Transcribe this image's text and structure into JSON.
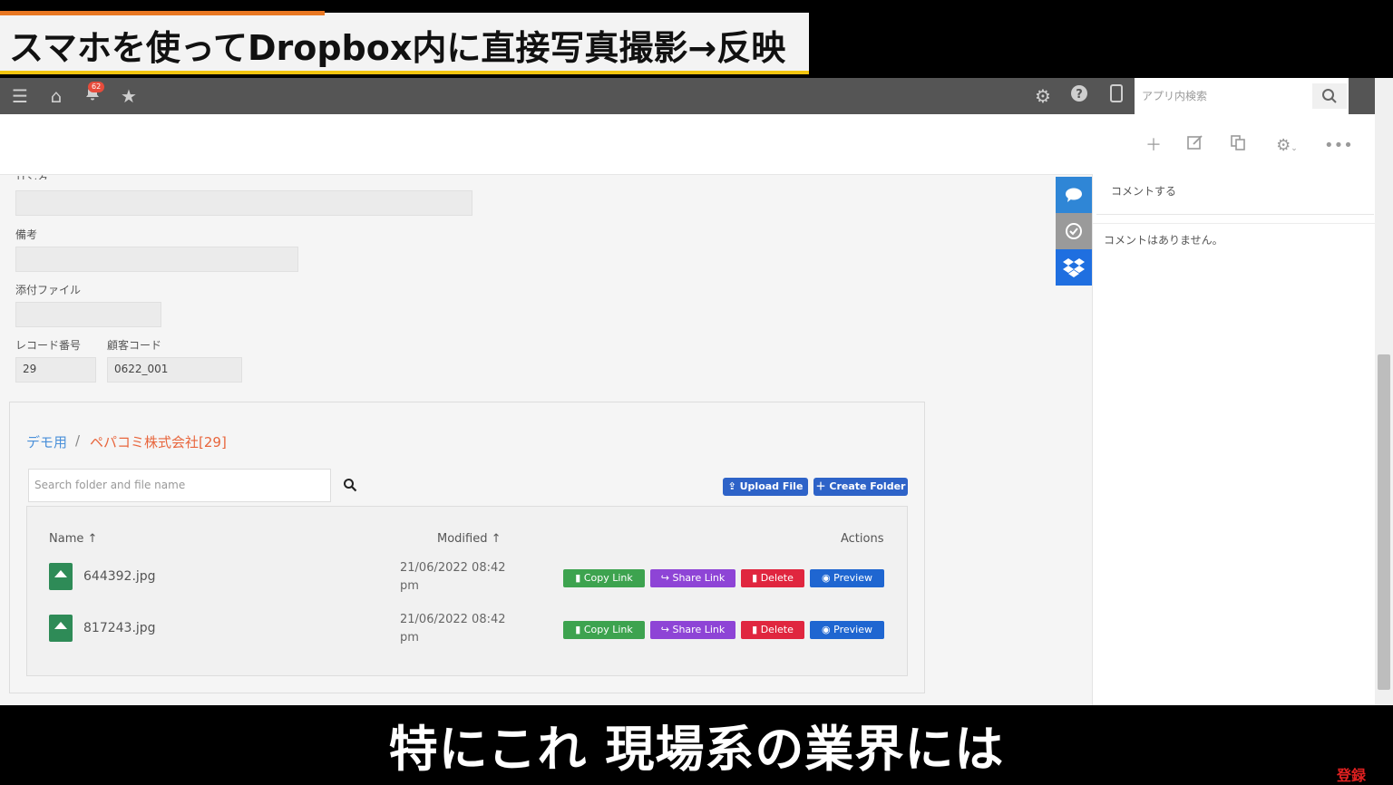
{
  "title": "スマホを使ってDropbox内に直接写真撮影→反映",
  "subtitle": "特にこれ 現場系の業界には",
  "corner_badge": "登録",
  "topbar": {
    "notification_count": "62",
    "search_placeholder": "アプリ内検索"
  },
  "record": {
    "partial_label": "リンク",
    "note_label": "備考",
    "attachment_label": "添付ファイル",
    "record_no_label": "レコード番号",
    "record_no_value": "29",
    "customer_code_label": "顧客コード",
    "customer_code_value": "0622_001"
  },
  "dropbox": {
    "breadcrumb_root": "デモ用",
    "breadcrumb_sep": "/",
    "breadcrumb_current": "ペパコミ株式会社[29]",
    "search_placeholder": "Search folder and file name",
    "upload_label": "Upload File",
    "create_folder_label": "Create Folder",
    "col_name": "Name",
    "col_modified": "Modified",
    "col_actions": "Actions",
    "files": [
      {
        "name": "644392.jpg",
        "modified_1": "21/06/2022 08:42",
        "modified_2": "pm"
      },
      {
        "name": "817243.jpg",
        "modified_1": "21/06/2022 08:42",
        "modified_2": "pm"
      }
    ],
    "actions": {
      "copy": "Copy Link",
      "share": "Share Link",
      "delete": "Delete",
      "preview": "Preview"
    }
  },
  "comments": {
    "input_placeholder": "コメントする",
    "empty_text": "コメントはありません。"
  },
  "colors": {
    "accent_orange": "#e87722",
    "dropbox_blue": "#2e63c8",
    "copy_green": "#3da34f",
    "share_purple": "#8e44d6",
    "delete_red": "#e0263f",
    "preview_blue": "#1f66d1"
  }
}
